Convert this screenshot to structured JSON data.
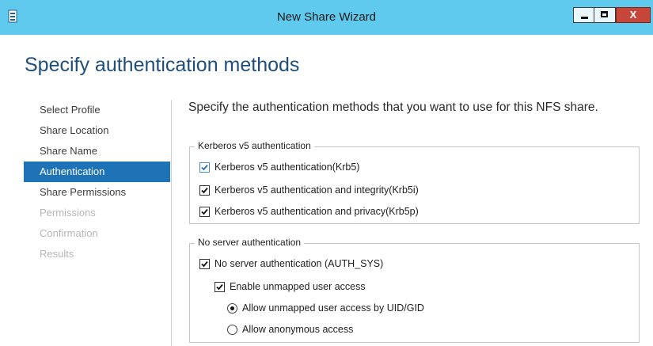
{
  "window": {
    "title": "New Share Wizard",
    "close_symbol": "X",
    "app_icon": "server-manager-icon"
  },
  "page": {
    "title": "Specify authentication methods",
    "instructions": "Specify the authentication methods that you want to use for this NFS share."
  },
  "nav": {
    "items": [
      {
        "label": "Select Profile",
        "state": "normal"
      },
      {
        "label": "Share Location",
        "state": "normal"
      },
      {
        "label": "Share Name",
        "state": "normal"
      },
      {
        "label": "Authentication",
        "state": "active"
      },
      {
        "label": "Share Permissions",
        "state": "normal"
      },
      {
        "label": "Permissions",
        "state": "disabled"
      },
      {
        "label": "Confirmation",
        "state": "disabled"
      },
      {
        "label": "Results",
        "state": "disabled"
      }
    ]
  },
  "kerberos": {
    "legend": "Kerberos v5 authentication",
    "options": [
      {
        "label": "Kerberos v5 authentication(Krb5)",
        "checked": true
      },
      {
        "label": "Kerberos v5 authentication and integrity(Krb5i)",
        "checked": true
      },
      {
        "label": "Kerberos v5 authentication and privacy(Krb5p)",
        "checked": true
      }
    ]
  },
  "no_server_auth": {
    "legend": "No server authentication",
    "auth_sys_label": "No server authentication (AUTH_SYS)",
    "auth_sys_checked": true,
    "unmapped_label": "Enable unmapped user access",
    "unmapped_checked": true,
    "radio_uid_gid_label": "Allow unmapped user access by UID/GID",
    "radio_uid_gid_selected": true,
    "radio_anonymous_label": "Allow anonymous access",
    "radio_anonymous_selected": false
  },
  "colors": {
    "titlebar": "#5fc9ee",
    "nav_active": "#1e72b6",
    "page_title": "#1e4e79",
    "close_button": "#c7463a"
  }
}
